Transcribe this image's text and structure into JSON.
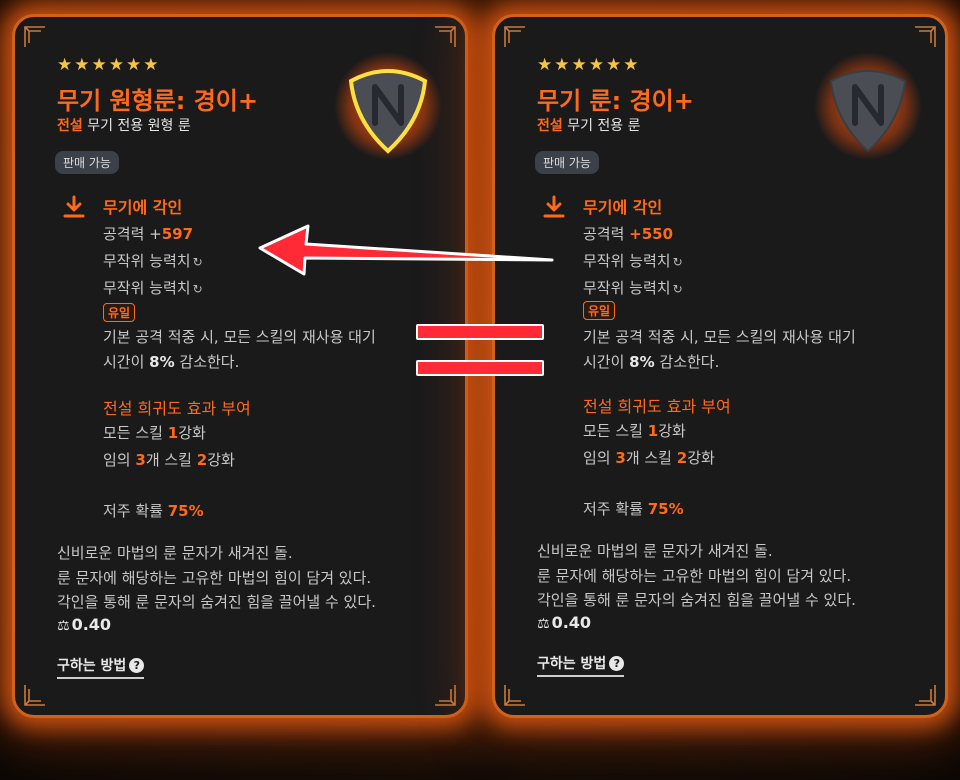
{
  "cards": [
    {
      "stars": 6,
      "title": "무기 원형룬: 경이+",
      "grade": "전설",
      "desc": "무기 전용 원형 룬",
      "badge": "판매 가능",
      "engrave_title": "무기에 각인",
      "attack_label": "공격력 +",
      "attack_value": "597",
      "random_stat": "무작위 능력치",
      "unique_label": "유일",
      "effect_line1_pre": "기본 공격 적중 시, 모든 스킬의 재사용 대기",
      "effect_line2_pre": "시간이 ",
      "effect_pct": "8%",
      "effect_line2_post": " 감소한다.",
      "rarity_title": "전설 희귀도 효과 부여",
      "skill1_pre": "모든 스킬 ",
      "skill1_num": "1",
      "skill1_post": "강화",
      "skill2_pre": "임의 ",
      "skill2_num1": "3",
      "skill2_mid": "개 스킬 ",
      "skill2_num2": "2",
      "skill2_post": "강화",
      "curse_label": "저주 확률 ",
      "curse_value": "75%",
      "flavor1": "신비로운 마법의 룬 문자가 새겨진 돌.",
      "flavor2": "룬 문자에 해당하는 고유한 마법의 힘이 담겨 있다.",
      "flavor3": "각인을 통해 룬 문자의 숨겨진 힘을 끌어낼 수 있다.",
      "weight": "0.40",
      "howto": "구하는 방법"
    },
    {
      "stars": 6,
      "title": "무기 룬: 경이+",
      "grade": "전설",
      "desc": "무기 전용 룬",
      "badge": "판매 가능",
      "engrave_title": "무기에 각인",
      "attack_label": "공격력 ",
      "attack_value": "+550",
      "random_stat": "무작위 능력치",
      "unique_label": "유일",
      "effect_line1_pre": "기본 공격 적중 시, 모든 스킬의 재사용 대기",
      "effect_line2_pre": "시간이 ",
      "effect_pct": "8%",
      "effect_line2_post": " 감소한다.",
      "rarity_title": "전설 희귀도 효과 부여",
      "skill1_pre": "모든 스킬 ",
      "skill1_num": "1",
      "skill1_post": "강화",
      "skill2_pre": "임의 ",
      "skill2_num1": "3",
      "skill2_mid": "개 스킬 ",
      "skill2_num2": "2",
      "skill2_post": "강화",
      "curse_label": "저주 확률 ",
      "curse_value": "75%",
      "flavor1": "신비로운 마법의 룬 문자가 새겨진 돌.",
      "flavor2": "룬 문자에 해당하는 고유한 마법의 힘이 담겨 있다.",
      "flavor3": "각인을 통해 룬 문자의 숨겨진 힘을 끌어낼 수 있다.",
      "weight": "0.40",
      "howto": "구하는 방법"
    }
  ],
  "icons": {
    "star": "star-icon",
    "rune": "rune-stone-icon",
    "engrave": "download-arrow-icon",
    "refresh": "refresh-icon",
    "weight": "weight-icon",
    "help": "question-icon",
    "arrow": "left-arrow-icon"
  },
  "colors": {
    "accent": "#ff6a1a",
    "border": "#d0621c",
    "star": "#f4c44a",
    "arrow": "#ff2a36",
    "card_bg": "#1a1a1b"
  }
}
